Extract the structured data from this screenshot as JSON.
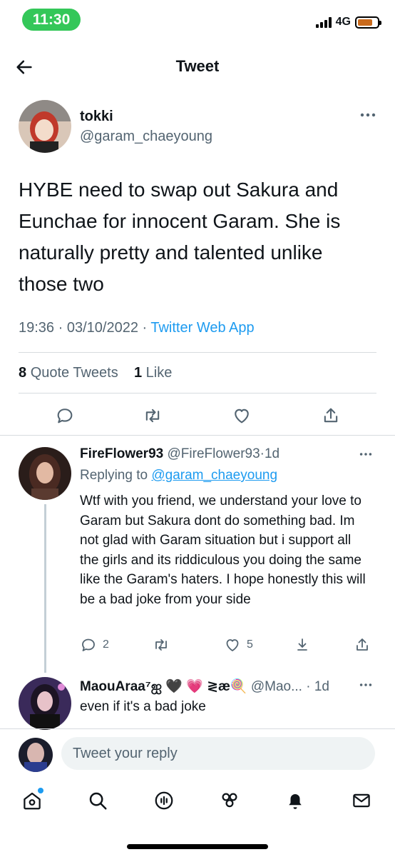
{
  "status_bar": {
    "time": "11:30",
    "network": "4G"
  },
  "header": {
    "title": "Tweet"
  },
  "tweet": {
    "author_name": "tokki",
    "author_handle": "@garam_chaeyoung",
    "text": "HYBE need to swap out Sakura and Eunchae for innocent Garam. She is naturally pretty and talented unlike those two",
    "time": "19:36",
    "date": "03/10/2022",
    "source": "Twitter Web App",
    "quote_count": "8",
    "quote_label": "Quote Tweets",
    "like_count": "1",
    "like_label": "Like"
  },
  "replies": [
    {
      "name": "FireFlower93",
      "handle": "@FireFlower93",
      "age": "1d",
      "replying_prefix": "Replying to",
      "replying_to": "@garam_chaeyoung",
      "text": "Wtf with you friend, we understand your love to Garam but Sakura dont do something bad. Im not glad with Garam situation but i support all the girls and its riddiculous you doing the same like the Garam's haters. I hope honestly this will be a bad joke from your side",
      "reply_count": "2",
      "like_count": "5"
    },
    {
      "name": "MaouAraa⁷ஐ 🖤 💗 ≷æ🍭",
      "handle": "@Mao...",
      "age": "1d",
      "text": "even if it's a bad joke"
    }
  ],
  "composer": {
    "placeholder": "Tweet your reply"
  },
  "tabs": [
    "home-icon",
    "search-icon",
    "spaces-icon",
    "communities-icon",
    "notifications-icon",
    "messages-icon"
  ],
  "colors": {
    "accent": "#1d9bf0",
    "status_pill": "#34c759",
    "battery": "#c96a1c"
  }
}
